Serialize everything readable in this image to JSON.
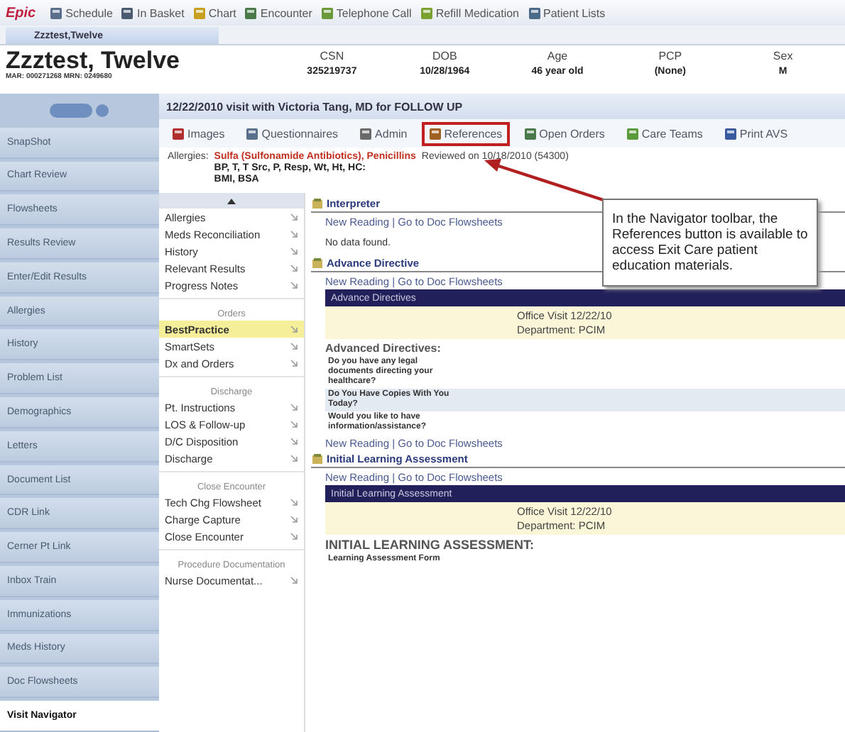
{
  "app_toolbar": {
    "logo": "Epic",
    "items": [
      {
        "label": "Schedule",
        "color": "#5a6f8c"
      },
      {
        "label": "In Basket",
        "color": "#4a5a70"
      },
      {
        "label": "Chart",
        "color": "#c8a020"
      },
      {
        "label": "Encounter",
        "color": "#4a7a4a"
      },
      {
        "label": "Telephone Call",
        "color": "#6a9a3a"
      },
      {
        "label": "Refill Medication",
        "color": "#7aa030"
      },
      {
        "label": "Patient Lists",
        "color": "#4a6a8a"
      }
    ]
  },
  "tabs": [
    {
      "label": "Zzztest,Twelve",
      "selected": true
    }
  ],
  "patient": {
    "name": "Zzztest, Twelve",
    "ids": "MAR: 000271268 MRN: 0249680",
    "fields": [
      {
        "label": "CSN",
        "value": "325219737"
      },
      {
        "label": "DOB",
        "value": "10/28/1964"
      },
      {
        "label": "Age",
        "value": "46 year old"
      },
      {
        "label": "PCP",
        "value": "(None)"
      },
      {
        "label": "Sex",
        "value": "M"
      }
    ]
  },
  "sidebar": {
    "items": [
      {
        "label": "SnapShot",
        "selected": false
      },
      {
        "label": "Chart Review",
        "selected": false
      },
      {
        "label": "Flowsheets",
        "selected": false
      },
      {
        "label": "Results Review",
        "selected": false
      },
      {
        "label": "Enter/Edit Results",
        "selected": false
      },
      {
        "label": "Allergies",
        "selected": false
      },
      {
        "label": "History",
        "selected": false
      },
      {
        "label": "Problem List",
        "selected": false
      },
      {
        "label": "Demographics",
        "selected": false
      },
      {
        "label": "Letters",
        "selected": false
      },
      {
        "label": "Document List",
        "selected": false
      },
      {
        "label": "CDR Link",
        "selected": false
      },
      {
        "label": "Cerner Pt Link",
        "selected": false
      },
      {
        "label": "Inbox Train",
        "selected": false
      },
      {
        "label": "Immunizations",
        "selected": false
      },
      {
        "label": "Meds History",
        "selected": false
      },
      {
        "label": "Doc Flowsheets",
        "selected": false
      },
      {
        "label": "Visit Navigator",
        "selected": true
      }
    ]
  },
  "visit": {
    "title": "12/22/2010 visit with Victoria Tang, MD for FOLLOW UP",
    "toolbar": [
      {
        "label": "Images",
        "highlighted": false,
        "color": "#b03030"
      },
      {
        "label": "Questionnaires",
        "highlighted": false,
        "color": "#5a6f8c"
      },
      {
        "label": "Admin",
        "highlighted": false,
        "color": "#6a6a6a"
      },
      {
        "label": "References",
        "highlighted": true,
        "color": "#a06020"
      },
      {
        "label": "Open Orders",
        "highlighted": false,
        "color": "#4a7a4a"
      },
      {
        "label": "Care Teams",
        "highlighted": false,
        "color": "#5a9a3a"
      },
      {
        "label": "Print AVS",
        "highlighted": false,
        "color": "#3a5aa0"
      }
    ]
  },
  "allergies": {
    "label": "Allergies:",
    "list": "Sulfa (Sulfonamide Antibiotics), Penicillins",
    "reviewed": "Reviewed on 10/18/2010 (54300)",
    "vitals": [
      "BP, T, T Src, P, Resp, Wt, Ht, HC:",
      "BMI, BSA"
    ]
  },
  "navigator": {
    "items": [
      {
        "kind": "item",
        "label": "Allergies",
        "selected": false
      },
      {
        "kind": "item",
        "label": "Meds Reconciliation",
        "selected": false
      },
      {
        "kind": "item",
        "label": "History",
        "selected": false
      },
      {
        "kind": "item",
        "label": "Relevant Results",
        "selected": false
      },
      {
        "kind": "item",
        "label": "Progress Notes",
        "selected": false
      },
      {
        "kind": "heading",
        "label": "Orders"
      },
      {
        "kind": "item",
        "label": "BestPractice",
        "selected": true
      },
      {
        "kind": "item",
        "label": "SmartSets",
        "selected": false
      },
      {
        "kind": "item",
        "label": "Dx and Orders",
        "selected": false
      },
      {
        "kind": "heading",
        "label": "Discharge"
      },
      {
        "kind": "item",
        "label": "Pt. Instructions",
        "selected": false
      },
      {
        "kind": "item",
        "label": "LOS & Follow-up",
        "selected": false
      },
      {
        "kind": "item",
        "label": "D/C Disposition",
        "selected": false
      },
      {
        "kind": "item",
        "label": "Discharge",
        "selected": false
      },
      {
        "kind": "heading",
        "label": "Close Encounter"
      },
      {
        "kind": "item",
        "label": "Tech Chg Flowsheet",
        "selected": false
      },
      {
        "kind": "item",
        "label": "Charge Capture",
        "selected": false
      },
      {
        "kind": "item",
        "label": "Close Encounter",
        "selected": false
      },
      {
        "kind": "heading",
        "label": "Procedure Documentation"
      },
      {
        "kind": "item",
        "label": "Nurse Documentat...",
        "selected": false
      }
    ]
  },
  "content": {
    "blocks": [
      {
        "kind": "section",
        "label": "Interpreter"
      },
      {
        "kind": "link",
        "label": "New Reading | Go to Doc Flowsheets"
      },
      {
        "kind": "note",
        "label": "No data found."
      },
      {
        "kind": "section",
        "label": "Advance Directive"
      },
      {
        "kind": "link",
        "label": "New Reading | Go to Doc Flowsheets"
      },
      {
        "kind": "bar",
        "label": "Advance Directives"
      },
      {
        "kind": "panel",
        "lines": [
          "Office Visit 12/22/10",
          "Department: PCIM"
        ]
      },
      {
        "kind": "subheading",
        "label": "Advanced Directives:"
      },
      {
        "kind": "question",
        "label": "Do you have any legal documents directing your healthcare?",
        "shaded": false
      },
      {
        "kind": "question",
        "label": "Do You Have Copies With You Today?",
        "shaded": true
      },
      {
        "kind": "question",
        "label": "Would you like to have information/assistance?",
        "shaded": false
      },
      {
        "kind": "link",
        "label": "New Reading | Go to Doc Flowsheets"
      },
      {
        "kind": "section",
        "label": "Initial Learning Assessment"
      },
      {
        "kind": "link",
        "label": "New Reading | Go to Doc Flowsheets"
      },
      {
        "kind": "bar",
        "label": "Initial Learning Assessment"
      },
      {
        "kind": "panel",
        "lines": [
          "Office Visit 12/22/10",
          "Department: PCIM"
        ]
      },
      {
        "kind": "heading",
        "label": "INITIAL LEARNING ASSESSMENT:"
      },
      {
        "kind": "question",
        "label": "Learning Assessment Form",
        "shaded": false
      }
    ]
  },
  "callout": {
    "text": "In the Navigator toolbar, the References button is available to access Exit Care patient education materials."
  }
}
